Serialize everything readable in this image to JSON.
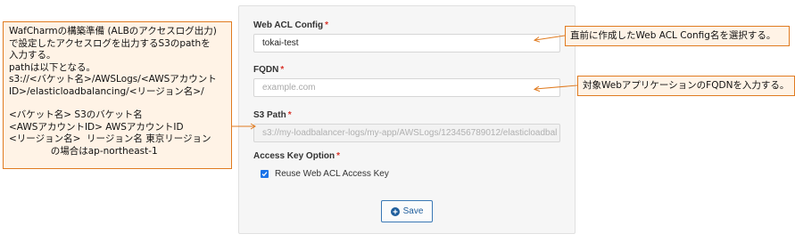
{
  "left_note": {
    "lines": [
      "WafCharmの構築準備 (ALBのアクセスログ出力)",
      "で設定したアクセスログを出力するS3のpathを",
      "入力する。",
      "pathは以下となる。",
      "s3://<バケット名>/AWSLogs/<AWSアカウント",
      "ID>/elasticloadbalancing/<リージョン名>/"
    ],
    "lines2": [
      "<バケット名> S3のバケット名",
      "<AWSアカウントID> AWSアカウントID",
      "<リージョン名>  リージョン名 東京リージョン",
      "              の場合はap-northeast-1"
    ]
  },
  "form": {
    "web_acl_config": {
      "label": "Web ACL Config",
      "required": "*",
      "value": "tokai-test"
    },
    "fqdn": {
      "label": "FQDN",
      "required": "*",
      "placeholder": "example.com"
    },
    "s3_path": {
      "label": "S3 Path",
      "required": "*",
      "placeholder": "s3://my-loadbalancer-logs/my-app/AWSLogs/123456789012/elasticloadbal"
    },
    "access_key_option": {
      "label": "Access Key Option",
      "required": "*",
      "checkbox_label": "Reuse Web ACL Access Key",
      "checked": true
    },
    "save_label": "Save"
  },
  "right_notes": {
    "web_acl": "直前に作成したWeb ACL Config名を選択する。",
    "fqdn": "対象WebアプリケーションのFQDNを入力する。"
  },
  "colors": {
    "callout_border": "#e07b20",
    "callout_fill": "#fff3e6",
    "required": "#d9342b",
    "accent": "#1f5e9c"
  }
}
